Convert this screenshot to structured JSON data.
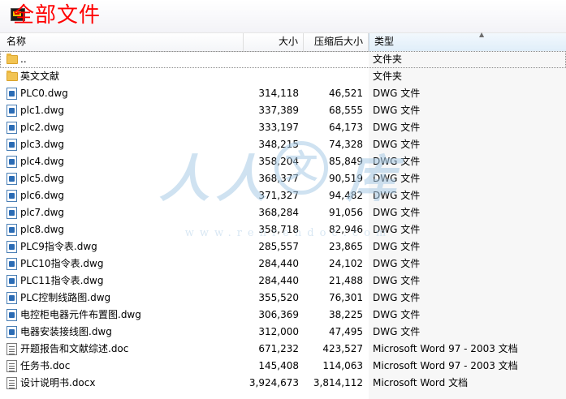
{
  "title": "全部文件",
  "columns": {
    "name": "名称",
    "size": "大小",
    "compressed": "压缩后大小",
    "type": "类型"
  },
  "rows": [
    {
      "icon": "folder",
      "name": "..",
      "size": "",
      "compressed": "",
      "type": "文件夹"
    },
    {
      "icon": "folder",
      "name": "英文文献",
      "size": "",
      "compressed": "",
      "type": "文件夹"
    },
    {
      "icon": "dwg",
      "name": "PLC0.dwg",
      "size": "314,118",
      "compressed": "46,521",
      "type": "DWG 文件"
    },
    {
      "icon": "dwg",
      "name": "plc1.dwg",
      "size": "337,389",
      "compressed": "68,555",
      "type": "DWG 文件"
    },
    {
      "icon": "dwg",
      "name": "plc2.dwg",
      "size": "333,197",
      "compressed": "64,173",
      "type": "DWG 文件"
    },
    {
      "icon": "dwg",
      "name": "plc3.dwg",
      "size": "348,215",
      "compressed": "74,328",
      "type": "DWG 文件"
    },
    {
      "icon": "dwg",
      "name": "plc4.dwg",
      "size": "358,204",
      "compressed": "85,849",
      "type": "DWG 文件"
    },
    {
      "icon": "dwg",
      "name": "plc5.dwg",
      "size": "368,377",
      "compressed": "90,519",
      "type": "DWG 文件"
    },
    {
      "icon": "dwg",
      "name": "plc6.dwg",
      "size": "371,327",
      "compressed": "94,482",
      "type": "DWG 文件"
    },
    {
      "icon": "dwg",
      "name": "plc7.dwg",
      "size": "368,284",
      "compressed": "91,056",
      "type": "DWG 文件"
    },
    {
      "icon": "dwg",
      "name": "plc8.dwg",
      "size": "358,718",
      "compressed": "82,946",
      "type": "DWG 文件"
    },
    {
      "icon": "dwg",
      "name": "PLC9指令表.dwg",
      "size": "285,557",
      "compressed": "23,865",
      "type": "DWG 文件"
    },
    {
      "icon": "dwg",
      "name": "PLC10指令表.dwg",
      "size": "284,440",
      "compressed": "24,102",
      "type": "DWG 文件"
    },
    {
      "icon": "dwg",
      "name": "PLC11指令表.dwg",
      "size": "284,440",
      "compressed": "21,488",
      "type": "DWG 文件"
    },
    {
      "icon": "dwg",
      "name": "PLC控制线路图.dwg",
      "size": "355,520",
      "compressed": "76,301",
      "type": "DWG 文件"
    },
    {
      "icon": "dwg",
      "name": "电控柜电器元件布置图.dwg",
      "size": "306,369",
      "compressed": "38,225",
      "type": "DWG 文件"
    },
    {
      "icon": "dwg",
      "name": "电器安装接线图.dwg",
      "size": "312,000",
      "compressed": "47,495",
      "type": "DWG 文件"
    },
    {
      "icon": "doc",
      "name": "开题报告和文献综述.doc",
      "size": "671,232",
      "compressed": "423,527",
      "type": "Microsoft Word 97 - 2003 文档"
    },
    {
      "icon": "doc",
      "name": "任务书.doc",
      "size": "145,408",
      "compressed": "114,063",
      "type": "Microsoft Word 97 - 2003 文档"
    },
    {
      "icon": "doc",
      "name": "设计说明书.docx",
      "size": "3,924,673",
      "compressed": "3,814,112",
      "type": "Microsoft Word 文档"
    }
  ],
  "watermark": {
    "glyph1": "人",
    "glyph2": "人",
    "glyph3": "文",
    "glyph4": "库",
    "url": "www.renrendoc.com"
  }
}
